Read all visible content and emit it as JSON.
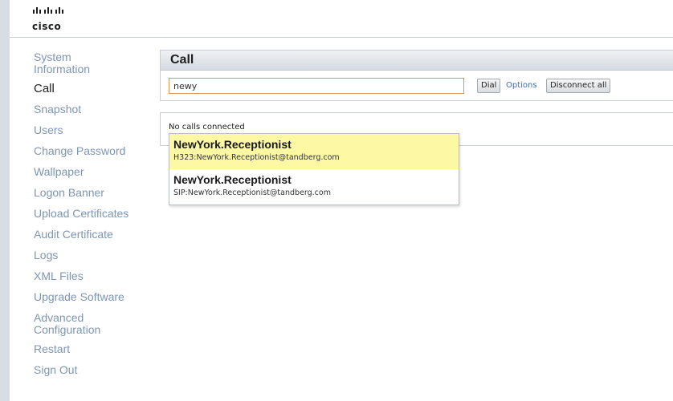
{
  "brand": {
    "logo_text": "cisco"
  },
  "sidebar": {
    "items": [
      {
        "label": "System Information",
        "active": false
      },
      {
        "label": "Call",
        "active": true
      },
      {
        "label": "Snapshot",
        "active": false
      },
      {
        "label": "Users",
        "active": false
      },
      {
        "label": "Change Password",
        "active": false
      },
      {
        "label": "Wallpaper",
        "active": false
      },
      {
        "label": "Logon Banner",
        "active": false
      },
      {
        "label": "Upload Certificates",
        "active": false
      },
      {
        "label": "Audit Certificate",
        "active": false
      },
      {
        "label": "Logs",
        "active": false
      },
      {
        "label": "XML Files",
        "active": false
      },
      {
        "label": "Upgrade Software",
        "active": false
      },
      {
        "label": "Advanced Configuration",
        "active": false
      },
      {
        "label": "Restart",
        "active": false
      },
      {
        "label": "Sign Out",
        "active": false
      }
    ]
  },
  "call": {
    "title": "Call",
    "search_value": "newy",
    "dial_label": "Dial",
    "options_label": "Options",
    "disconnect_label": "Disconnect all",
    "status": "No calls connected"
  },
  "suggestions": [
    {
      "name": "NewYork.Receptionist",
      "uri": "H323:NewYork.Receptionist@tandberg.com",
      "highlighted": true
    },
    {
      "name": "NewYork.Receptionist",
      "uri": "SIP:NewYork.Receptionist@tandberg.com",
      "highlighted": false
    }
  ],
  "colors": {
    "nav_link": "#7e96b3",
    "input_focus_border": "#e2954c",
    "suggestion_highlight": "#fcf8a4"
  }
}
